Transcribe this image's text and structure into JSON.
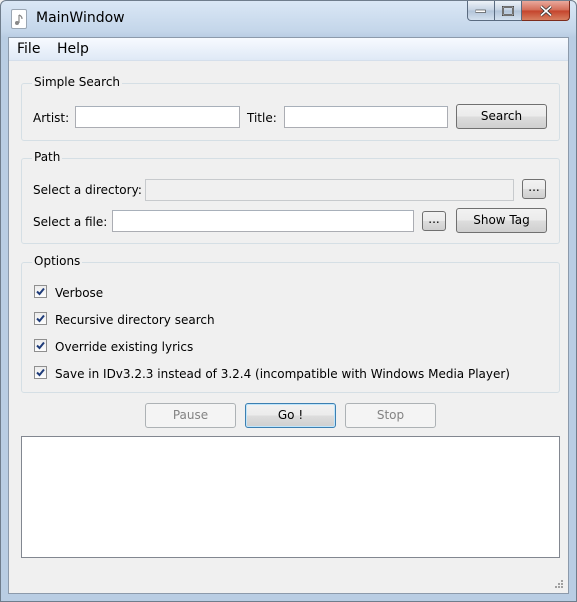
{
  "window": {
    "title": "MainWindow",
    "controls": {
      "minimize": "minimize-icon",
      "maximize": "maximize-icon",
      "close": "close-icon"
    }
  },
  "menu": {
    "file": "File",
    "help": "Help"
  },
  "simple_search": {
    "title": "Simple Search",
    "artist_label": "Artist:",
    "artist_value": "",
    "title_label": "Title:",
    "title_value": "",
    "search_button": "Search"
  },
  "path": {
    "title": "Path",
    "directory_label": "Select a directory:",
    "directory_value": "",
    "directory_browse": "...",
    "file_label": "Select a file:",
    "file_value": "",
    "file_browse": "...",
    "show_tag_button": "Show Tag"
  },
  "options": {
    "title": "Options",
    "items": [
      {
        "label": "Verbose",
        "checked": true
      },
      {
        "label": "Recursive directory search",
        "checked": true
      },
      {
        "label": "Override existing lyrics",
        "checked": true
      },
      {
        "label": "Save in IDv3.2.3 instead of 3.2.4 (incompatible with Windows Media Player)",
        "checked": true
      }
    ]
  },
  "actions": {
    "pause": "Pause",
    "go": "Go !",
    "stop": "Stop"
  },
  "log": {
    "text": ""
  },
  "colors": {
    "titlebar": "#c4d6ea",
    "close_button": "#c4432b",
    "focus_border": "#3c7fb1"
  }
}
